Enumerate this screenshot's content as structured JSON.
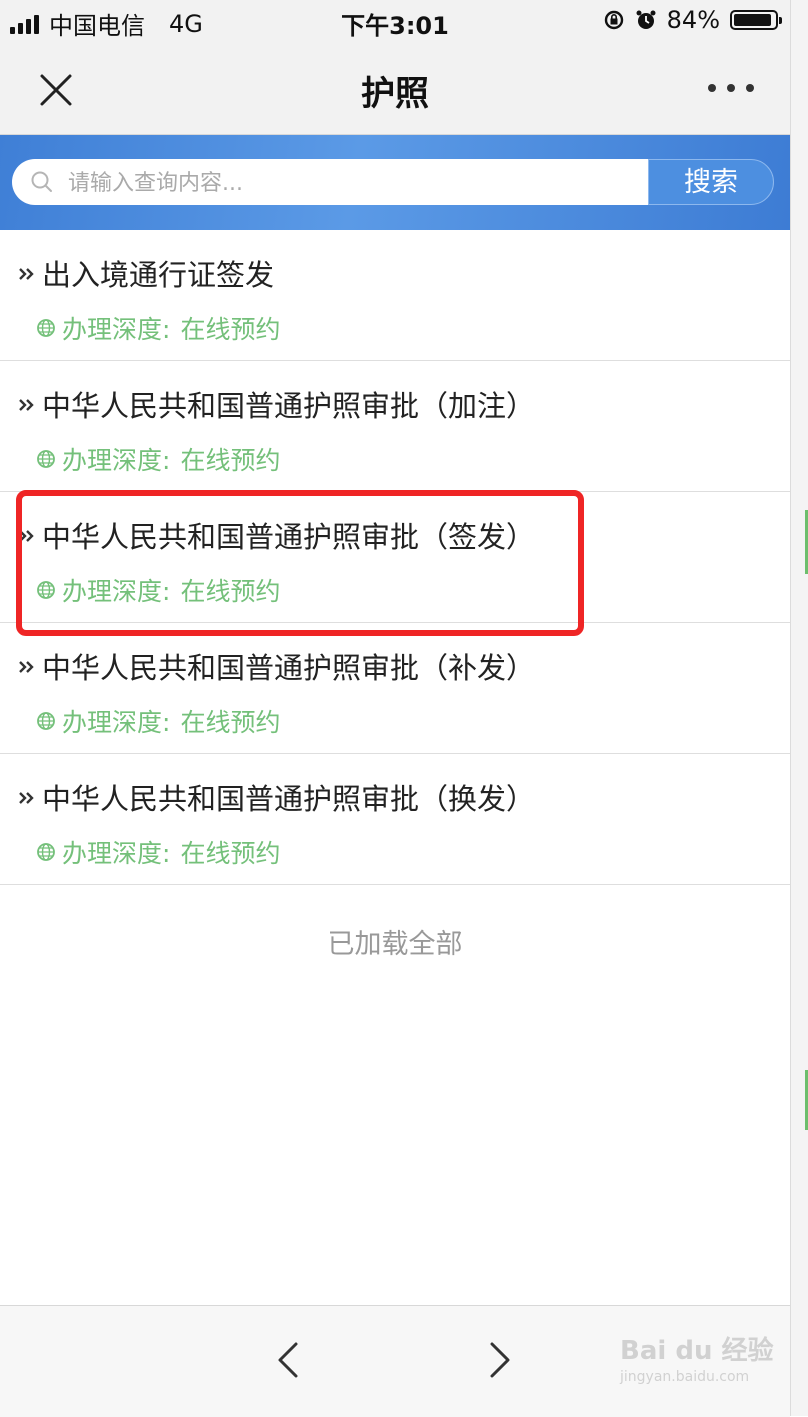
{
  "status_bar": {
    "carrier": "中国电信",
    "network": "4G",
    "time": "下午3:01",
    "battery": "84%"
  },
  "nav": {
    "title": "护照"
  },
  "search": {
    "placeholder": "请输入查询内容...",
    "button_label": "搜索"
  },
  "list": {
    "items": [
      {
        "name": "出入境通行证签发",
        "depth_label": "办理深度:",
        "depth_value": "在线预约"
      },
      {
        "name": "中华人民共和国普通护照审批（加注）",
        "depth_label": "办理深度:",
        "depth_value": "在线预约"
      },
      {
        "name": "中华人民共和国普通护照审批（签发）",
        "depth_label": "办理深度:",
        "depth_value": "在线预约"
      },
      {
        "name": "中华人民共和国普通护照审批（补发）",
        "depth_label": "办理深度:",
        "depth_value": "在线预约"
      },
      {
        "name": "中华人民共和国普通护照审批（换发）",
        "depth_label": "办理深度:",
        "depth_value": "在线预约"
      }
    ],
    "footer": "已加载全部"
  },
  "watermark": {
    "brand": "Bai du 经验",
    "site": "jingyan.baidu.com"
  },
  "colors": {
    "header_blue": "#4d8fe0",
    "meta_green": "#74c07a",
    "highlight_red": "#ef2525"
  }
}
